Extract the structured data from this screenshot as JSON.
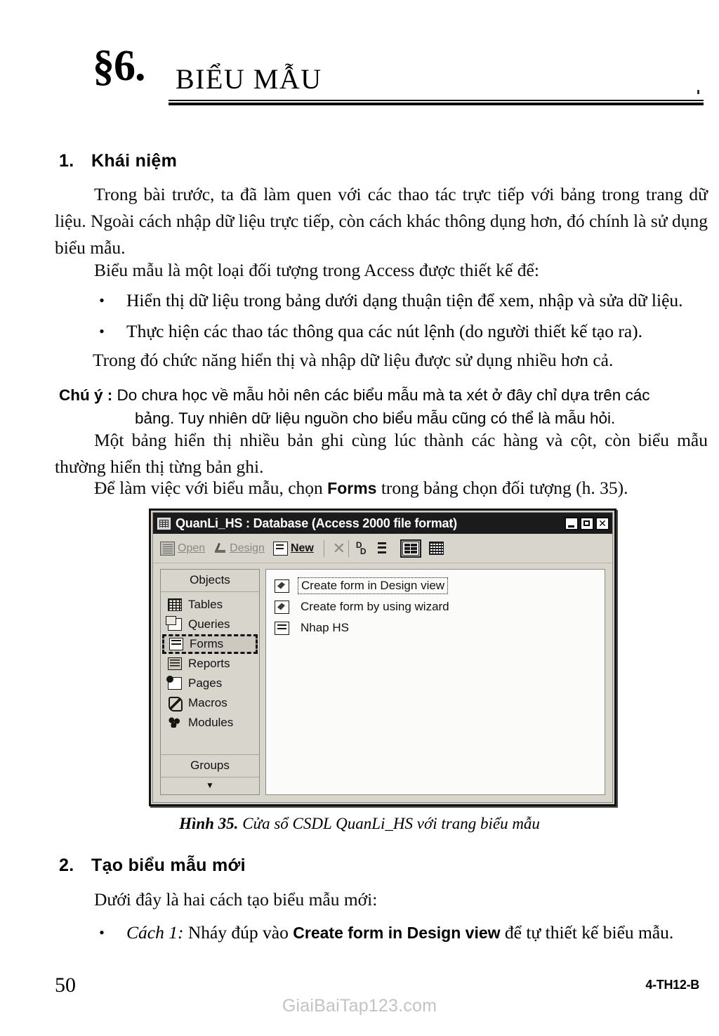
{
  "chapter": {
    "number": "§6.",
    "title": "BIỂU MẪU"
  },
  "sections": {
    "s1": {
      "number": "1.",
      "title": "Khái niệm",
      "p1": "Trong bài trước, ta đã làm quen với các thao tác trực tiếp với bảng trong trang dữ liệu. Ngoài cách nhập dữ liệu trực tiếp, còn cách khác thông dụng hơn, đó chính là sử dụng biểu mẫu.",
      "p2": "Biểu mẫu là một loại đối tượng trong Access được thiết kế để:",
      "bullet1": "Hiển thị dữ liệu trong bảng dưới dạng thuận tiện để xem, nhập và sửa dữ liệu.",
      "bullet2": "Thực hiện các thao tác thông qua các nút lệnh (do người thiết kế tạo ra).",
      "p3": "Trong đó chức năng hiển thị và nhập dữ liệu được sử dụng nhiều hơn cả.",
      "note_label": "Chú ý :",
      "note_line1": "Do chưa học về mẫu hỏi nên các biểu mẫu mà ta xét ở đây chỉ dựa trên các",
      "note_line2": "bảng. Tuy nhiên dữ liệu nguồn cho biểu mẫu cũng có thể là mẫu hỏi.",
      "p4": "Một bảng hiển thị nhiều bản ghi cùng lúc thành các hàng và cột, còn biểu mẫu thường hiển thị từng bản ghi.",
      "p5_before": "Để làm việc với biểu mẫu, chọn ",
      "p5_bold": "Forms",
      "p5_after": " trong bảng chọn đối tượng (h. 35)."
    },
    "s2": {
      "number": "2.",
      "title": "Tạo biểu mẫu mới",
      "p1": "Dưới đây là hai cách tạo biểu mẫu mới:",
      "bullet1_italic": "Cách 1:",
      "bullet1_before": " Nháy đúp vào ",
      "bullet1_bold": "Create form in Design view",
      "bullet1_after": " để tự thiết kế biểu mẫu."
    }
  },
  "figure": {
    "caption_number": "Hình 35.",
    "caption_text": " Cửa sổ CSDL QuanLi_HS với trang biểu mẫu",
    "window": {
      "title": "QuanLi_HS : Database (Access 2000 file format)",
      "titlebar_icon": "database-window-icon",
      "buttons": {
        "minimize": "minimize-icon",
        "maximize": "maximize-icon",
        "close": "✕"
      },
      "toolbar": [
        {
          "label": "Open",
          "icon": "open-icon",
          "enabled": false,
          "accel": "O"
        },
        {
          "label": "Design",
          "icon": "design-icon",
          "enabled": false,
          "accel": "D"
        },
        {
          "label": "New",
          "icon": "new-icon",
          "enabled": true,
          "accel": "N"
        }
      ],
      "toolbar_icons": [
        {
          "name": "delete-icon",
          "glyph": "✕",
          "pressed": false
        },
        {
          "name": "large-icons-icon",
          "glyph": "",
          "pressed": false
        },
        {
          "name": "small-icons-icon",
          "glyph": "",
          "pressed": false
        },
        {
          "name": "list-view-icon",
          "glyph": "",
          "pressed": true
        },
        {
          "name": "details-view-icon",
          "glyph": "",
          "pressed": false
        }
      ],
      "objects_header": "Objects",
      "objects": [
        {
          "label": "Tables",
          "icon": "tables-icon",
          "selected": false
        },
        {
          "label": "Queries",
          "icon": "queries-icon",
          "selected": false
        },
        {
          "label": "Forms",
          "icon": "forms-icon",
          "selected": true
        },
        {
          "label": "Reports",
          "icon": "reports-icon",
          "selected": false
        },
        {
          "label": "Pages",
          "icon": "pages-icon",
          "selected": false
        },
        {
          "label": "Macros",
          "icon": "macros-icon",
          "selected": false
        },
        {
          "label": "Modules",
          "icon": "modules-icon",
          "selected": false
        }
      ],
      "groups_label": "Groups",
      "expand_glyph": "▼",
      "list_items": [
        {
          "label": "Create form in Design view",
          "icon": "create-design-icon",
          "focused": true
        },
        {
          "label": "Create form by using wizard",
          "icon": "create-wizard-icon",
          "focused": false
        },
        {
          "label": "Nhap HS",
          "icon": "form-object-icon",
          "focused": false
        }
      ]
    }
  },
  "footer": {
    "page_number": "50",
    "signature": "4-TH12-B",
    "watermark": "GiaiBaiTap123.com"
  }
}
